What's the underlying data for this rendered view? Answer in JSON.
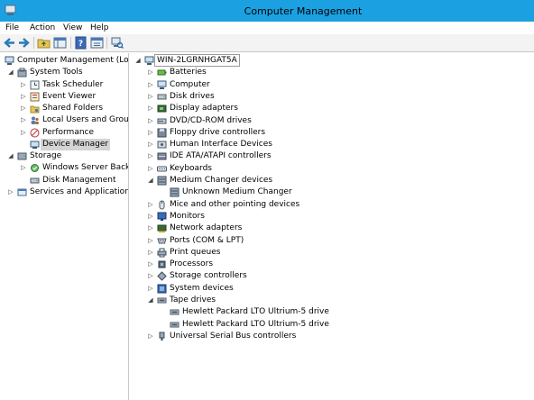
{
  "window": {
    "title": "Computer Management",
    "accent": "#1ba1e2"
  },
  "menu": [
    "File",
    "Action",
    "View",
    "Help"
  ],
  "toolbar": [
    "back-icon",
    "forward-icon",
    "up-folder-icon",
    "show-hide-tree-icon",
    "help-icon",
    "properties-icon",
    "scan-hardware-icon"
  ],
  "left_tree": [
    {
      "label": "Computer Management (Local",
      "level": 0,
      "expander": "",
      "icon": "computer-management-icon"
    },
    {
      "label": "System Tools",
      "level": 1,
      "expander": "◢",
      "icon": "system-tools-icon"
    },
    {
      "label": "Task Scheduler",
      "level": 2,
      "expander": "▷",
      "icon": "task-scheduler-icon"
    },
    {
      "label": "Event Viewer",
      "level": 2,
      "expander": "▷",
      "icon": "event-viewer-icon"
    },
    {
      "label": "Shared Folders",
      "level": 2,
      "expander": "▷",
      "icon": "shared-folders-icon"
    },
    {
      "label": "Local Users and Groups",
      "level": 2,
      "expander": "▷",
      "icon": "users-icon"
    },
    {
      "label": "Performance",
      "level": 2,
      "expander": "▷",
      "icon": "performance-icon"
    },
    {
      "label": "Device Manager",
      "level": 2,
      "expander": "",
      "icon": "device-manager-icon",
      "selected": true
    },
    {
      "label": "Storage",
      "level": 1,
      "expander": "◢",
      "icon": "storage-icon"
    },
    {
      "label": "Windows Server Backup",
      "level": 2,
      "expander": "▷",
      "icon": "backup-icon"
    },
    {
      "label": "Disk Management",
      "level": 2,
      "expander": "",
      "icon": "disk-management-icon"
    },
    {
      "label": "Services and Applications",
      "level": 1,
      "expander": "▷",
      "icon": "services-icon"
    }
  ],
  "device_tree": [
    {
      "label": "WIN-2LGRNHGAT5A",
      "level": 0,
      "expander": "◢",
      "icon": "computer-icon",
      "root": true
    },
    {
      "label": "Batteries",
      "level": 1,
      "expander": "▷",
      "icon": "battery-icon"
    },
    {
      "label": "Computer",
      "level": 1,
      "expander": "▷",
      "icon": "computer-icon"
    },
    {
      "label": "Disk drives",
      "level": 1,
      "expander": "▷",
      "icon": "disk-drive-icon"
    },
    {
      "label": "Display adapters",
      "level": 1,
      "expander": "▷",
      "icon": "display-adapter-icon"
    },
    {
      "label": "DVD/CD-ROM drives",
      "level": 1,
      "expander": "▷",
      "icon": "dvd-icon"
    },
    {
      "label": "Floppy drive controllers",
      "level": 1,
      "expander": "▷",
      "icon": "floppy-controller-icon"
    },
    {
      "label": "Human Interface Devices",
      "level": 1,
      "expander": "▷",
      "icon": "hid-icon"
    },
    {
      "label": "IDE ATA/ATAPI controllers",
      "level": 1,
      "expander": "▷",
      "icon": "ide-controller-icon"
    },
    {
      "label": "Keyboards",
      "level": 1,
      "expander": "▷",
      "icon": "keyboard-icon"
    },
    {
      "label": "Medium Changer devices",
      "level": 1,
      "expander": "◢",
      "icon": "medium-changer-icon"
    },
    {
      "label": "Unknown Medium Changer",
      "level": 2,
      "expander": "",
      "icon": "medium-changer-icon"
    },
    {
      "label": "Mice and other pointing devices",
      "level": 1,
      "expander": "▷",
      "icon": "mouse-icon"
    },
    {
      "label": "Monitors",
      "level": 1,
      "expander": "▷",
      "icon": "monitor-icon"
    },
    {
      "label": "Network adapters",
      "level": 1,
      "expander": "▷",
      "icon": "network-adapter-icon"
    },
    {
      "label": "Ports (COM & LPT)",
      "level": 1,
      "expander": "▷",
      "icon": "port-icon"
    },
    {
      "label": "Print queues",
      "level": 1,
      "expander": "▷",
      "icon": "printer-icon"
    },
    {
      "label": "Processors",
      "level": 1,
      "expander": "▷",
      "icon": "processor-icon"
    },
    {
      "label": "Storage controllers",
      "level": 1,
      "expander": "▷",
      "icon": "storage-controller-icon"
    },
    {
      "label": "System devices",
      "level": 1,
      "expander": "▷",
      "icon": "system-device-icon"
    },
    {
      "label": "Tape drives",
      "level": 1,
      "expander": "◢",
      "icon": "tape-drive-icon"
    },
    {
      "label": "Hewlett Packard LTO Ultrium-5 drive",
      "level": 2,
      "expander": "",
      "icon": "tape-drive-icon"
    },
    {
      "label": "Hewlett Packard LTO Ultrium-5 drive",
      "level": 2,
      "expander": "",
      "icon": "tape-drive-icon"
    },
    {
      "label": "Universal Serial Bus controllers",
      "level": 1,
      "expander": "▷",
      "icon": "usb-icon"
    }
  ]
}
